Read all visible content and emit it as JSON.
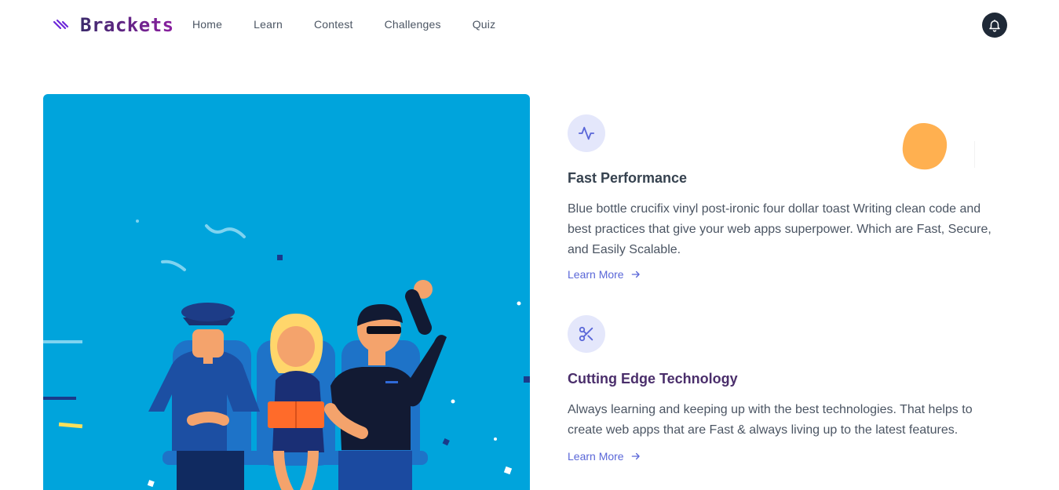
{
  "nav": {
    "logo_text": "Brackets",
    "logo_icon": "slashes-icon",
    "items": [
      {
        "label": "Home"
      },
      {
        "label": "Learn"
      },
      {
        "label": "Contest"
      },
      {
        "label": "Challenges"
      },
      {
        "label": "Quiz"
      }
    ],
    "bell_icon": "bell-icon"
  },
  "features": [
    {
      "icon": "activity-icon",
      "title": "Fast Performance",
      "description": "Blue bottle crucifix vinyl post-ironic four dollar toast Writing clean code and best practices that give your web apps superpower. Which are Fast, Secure, and Easily Scalable.",
      "link": "Learn More"
    },
    {
      "icon": "scissors-icon",
      "title": "Cutting Edge Technology",
      "description": "Always learning and keeping up with the best technologies. That helps to create web apps that are Fast & always living up to the latest features.",
      "link": "Learn More"
    }
  ],
  "colors": {
    "brand_purple": "#8b1fa0",
    "accent": "#5a67d8",
    "hero_bg": "#00a4dc",
    "icon_bg": "#e4e7fb",
    "blob": "#ffb050"
  }
}
